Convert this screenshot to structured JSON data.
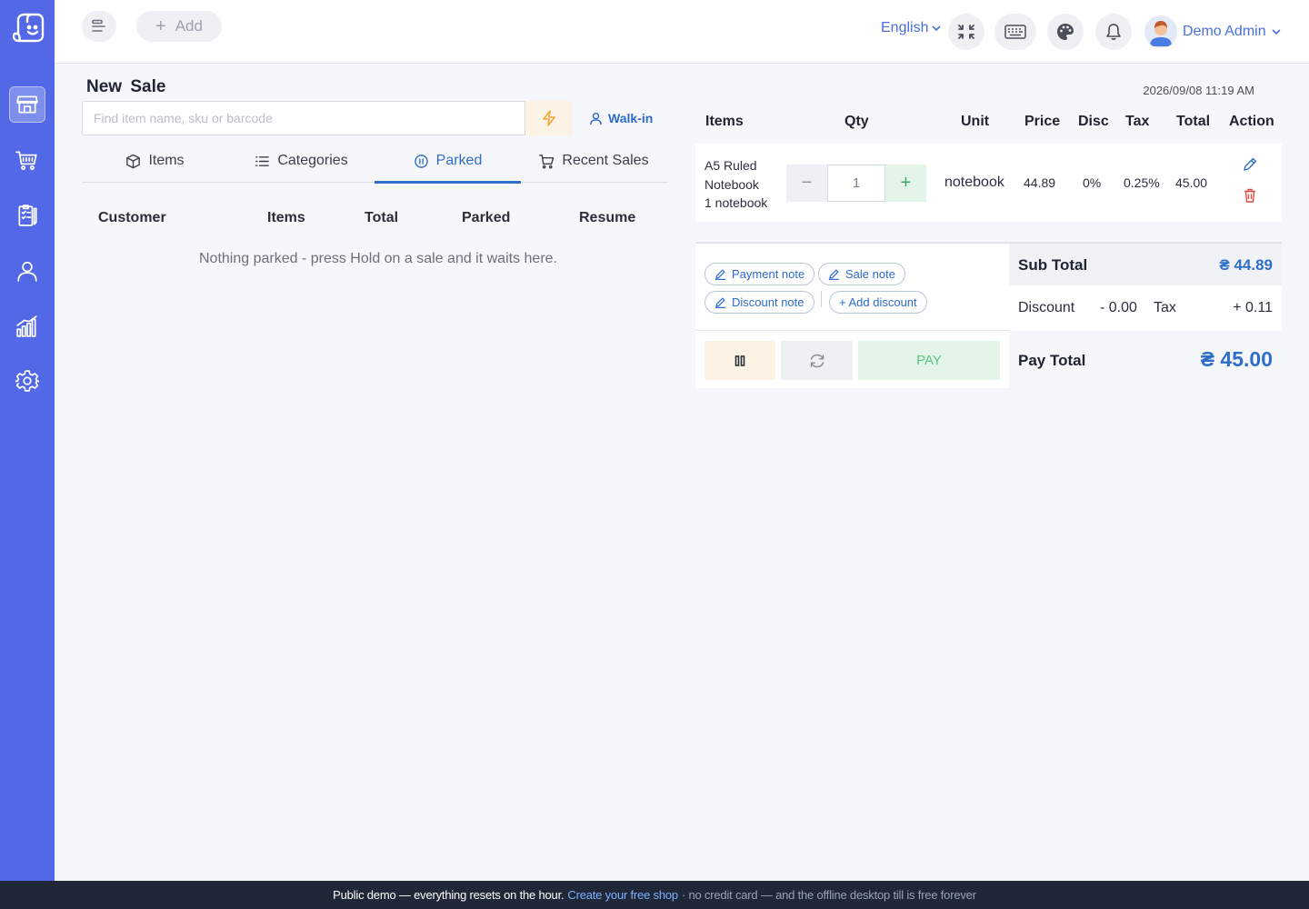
{
  "header": {
    "add_label": "Add",
    "language": "English",
    "user_name": "Demo Admin"
  },
  "sale": {
    "title": "New Sale",
    "search_placeholder": "Find item name, sku or barcode",
    "customer": "Walk-in",
    "tabs": [
      {
        "label": "Items",
        "icon": "box-icon"
      },
      {
        "label": "Categories",
        "icon": "list-icon"
      },
      {
        "label": "Parked",
        "icon": "pause-circle-icon",
        "active": true
      },
      {
        "label": "Recent Sales",
        "icon": "cart-icon"
      }
    ],
    "parked_columns": [
      "Customer",
      "Items",
      "Total",
      "Parked",
      "Resume"
    ],
    "empty_message": "Nothing parked - press Hold on a sale and it waits here."
  },
  "cart": {
    "datetime": "2026/09/08 11:19 AM",
    "columns": [
      "Items",
      "Qty",
      "Unit",
      "Price",
      "Disc",
      "Tax",
      "Total",
      "Action"
    ],
    "rows": [
      {
        "name_line1": "A5 Ruled",
        "name_line2": "Notebook",
        "name_line3": "1 notebook",
        "qty": "1",
        "unit": "notebook",
        "price": "44.89",
        "disc": "0%",
        "tax": "0.25%",
        "total": "45.00"
      }
    ]
  },
  "notes": {
    "payment_note": "Payment note",
    "sale_note": "Sale note",
    "discount_note": "Discount note",
    "add_discount": "+ Add discount",
    "pay_label": "PAY"
  },
  "totals": {
    "sub_total_label": "Sub Total",
    "sub_total_value": "₴ 44.89",
    "discount_label": "Discount",
    "discount_value": "- 0.00",
    "tax_label": "Tax",
    "tax_value": "+ 0.11",
    "pay_total_label": "Pay Total",
    "pay_total_value": "₴ 45.00"
  },
  "footer": {
    "part1": "Public demo — everything resets on the hour.",
    "link": "Create your free shop",
    "part2": "· no credit card — and the offline desktop till is free forever"
  },
  "colors": {
    "sidebar": "#5268e6",
    "accent": "#2f6ec9",
    "pay_green": "#5bc483",
    "footer_bg": "#1f2738"
  }
}
